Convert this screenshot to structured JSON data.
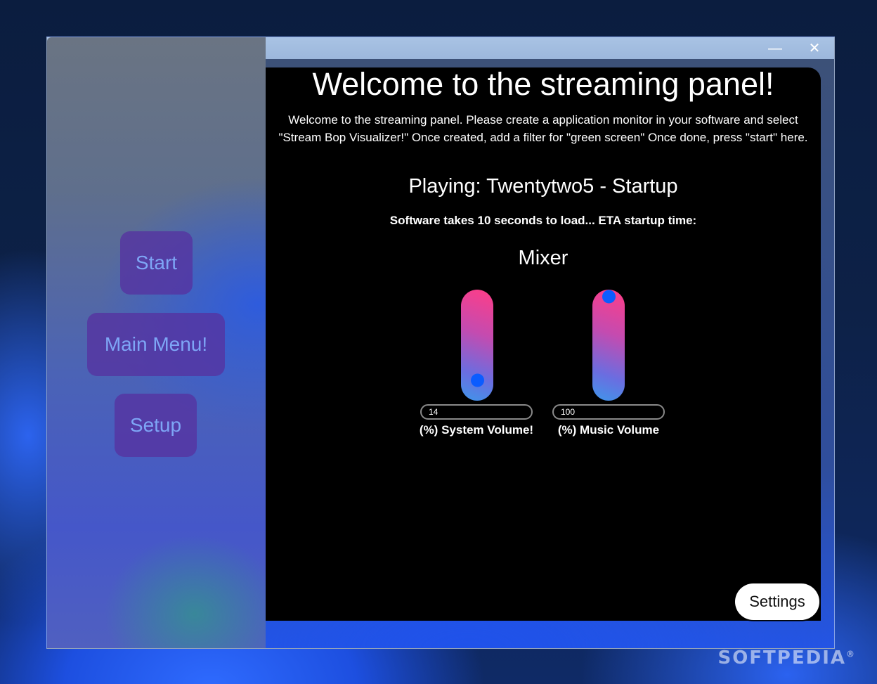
{
  "window": {
    "minimize_glyph": "—",
    "close_glyph": "✕"
  },
  "sidebar": {
    "start_label": "Start",
    "main_menu_label": "Main Menu!",
    "setup_label": "Setup"
  },
  "panel": {
    "title": "Welcome to the streaming panel!",
    "intro": "Welcome to the streaming panel. Please create a application monitor in your software and select \"Stream Bop Visualizer!\" Once created, add a filter for \"green screen\" Once done, press \"start\" here.",
    "now_playing": "Playing: Twentytwo5 - Startup",
    "eta": "Software takes 10 seconds to load... ETA startup time:",
    "mixer_title": "Mixer"
  },
  "mixer": {
    "system": {
      "value": "14",
      "level_percent": 14,
      "label": "(%) System Volume!"
    },
    "music": {
      "value": "100",
      "level_percent": 100,
      "label": "(%) Music Volume"
    }
  },
  "settings_label": "Settings",
  "watermark": "SOFTPEDIA",
  "colors": {
    "panel_bg": "#000000",
    "nav_button_bg": "#5632a0",
    "nav_button_text": "#7ea6f6",
    "knob": "#0b5cff",
    "slider_top": "#ff3d87",
    "slider_bottom": "#3f96ea"
  }
}
